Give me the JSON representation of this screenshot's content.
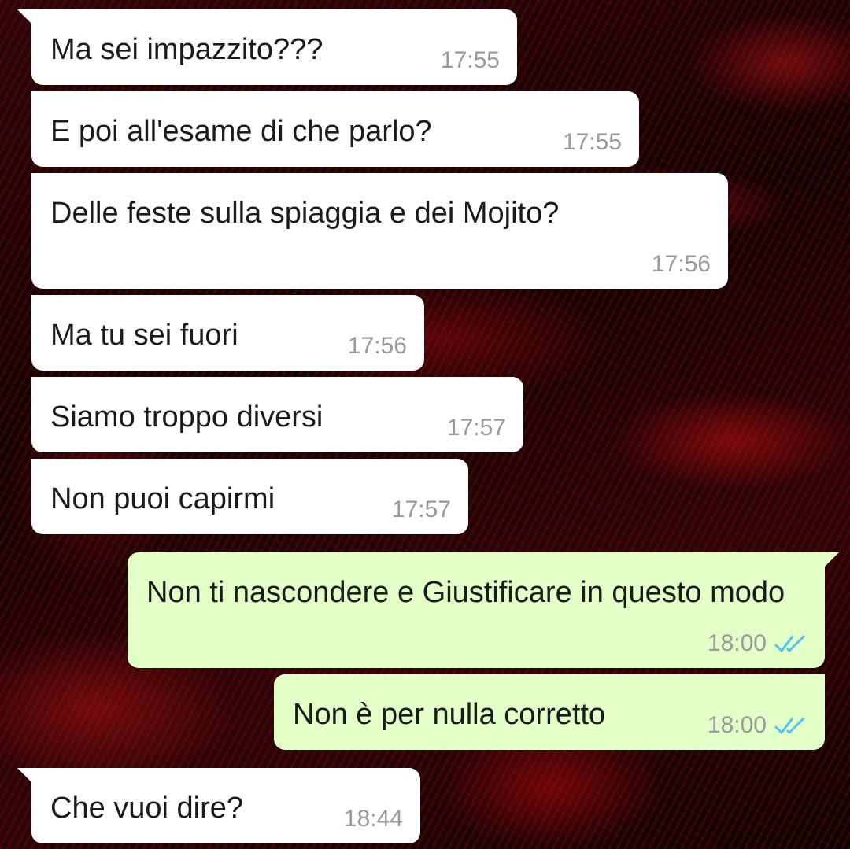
{
  "messages": [
    {
      "direction": "in",
      "text": "Ma sei impazzito???",
      "time": "17:55"
    },
    {
      "direction": "in",
      "text": "E poi all'esame di che parlo?",
      "time": "17:55"
    },
    {
      "direction": "in",
      "text": "Delle feste sulla spiaggia e dei Mojito?",
      "time": "17:56"
    },
    {
      "direction": "in",
      "text": "Ma tu sei fuori",
      "time": "17:56"
    },
    {
      "direction": "in",
      "text": "Siamo troppo diversi",
      "time": "17:57"
    },
    {
      "direction": "in",
      "text": "Non puoi capirmi",
      "time": "17:57"
    },
    {
      "direction": "out",
      "text": "Non ti nascondere e Giustificare in questo modo",
      "time": "18:00",
      "status": "read",
      "status_icon": "double-check-icon"
    },
    {
      "direction": "out",
      "text": "Non è per nulla corretto",
      "time": "18:00",
      "status": "read",
      "status_icon": "double-check-icon"
    },
    {
      "direction": "in",
      "text": "Che vuoi dire?",
      "time": "18:44"
    }
  ],
  "colors": {
    "incoming_bubble": "#ffffff",
    "outgoing_bubble": "#e1ffc7",
    "timestamp": "#9a9a9a",
    "read_ticks": "#4fc3f7"
  }
}
